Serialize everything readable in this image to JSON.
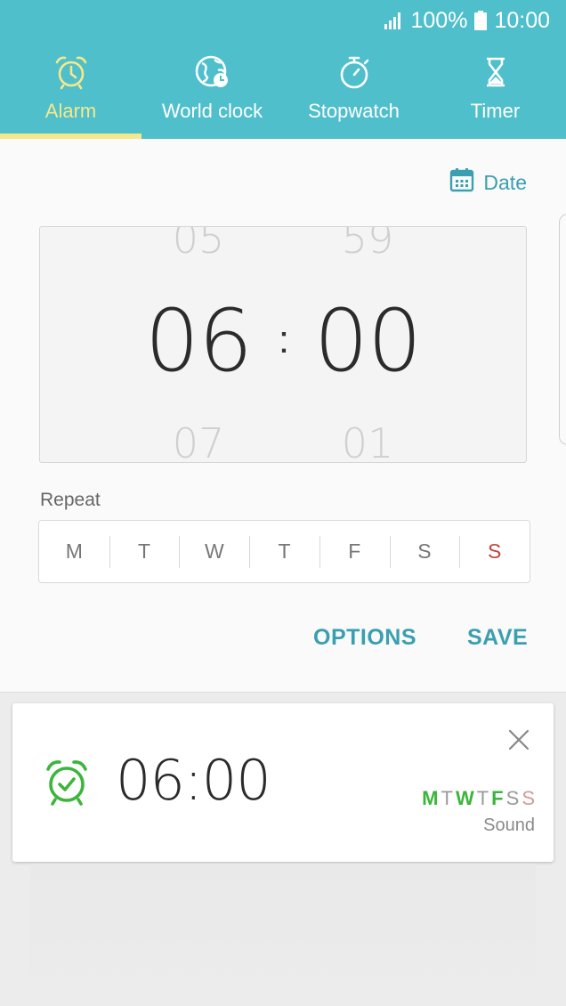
{
  "status": {
    "battery": "100%",
    "time": "10:00"
  },
  "tabs": [
    {
      "label": "Alarm",
      "icon": "alarm-clock-icon",
      "active": true
    },
    {
      "label": "World clock",
      "icon": "globe-clock-icon",
      "active": false
    },
    {
      "label": "Stopwatch",
      "icon": "stopwatch-icon",
      "active": false
    },
    {
      "label": "Timer",
      "icon": "hourglass-icon",
      "active": false
    }
  ],
  "editor": {
    "date_label": "Date",
    "picker": {
      "hour_prev": "05",
      "hour": "06",
      "hour_next": "07",
      "minute_prev": "59",
      "minute": "00",
      "minute_next": "01",
      "separator": ":"
    },
    "repeat_label": "Repeat",
    "days": [
      "M",
      "T",
      "W",
      "T",
      "F",
      "S",
      "S"
    ],
    "options_label": "OPTIONS",
    "save_label": "SAVE"
  },
  "alarm_card": {
    "time": "06:00",
    "days": [
      "M",
      "T",
      "W",
      "T",
      "F",
      "S",
      "S"
    ],
    "active_days": [
      true,
      false,
      true,
      false,
      true,
      false,
      false
    ],
    "sound_label": "Sound"
  },
  "colors": {
    "header": "#4fbfcc",
    "active_tab": "#f6e88a",
    "accent": "#3a9fb0",
    "alarm_on": "#3cb53c",
    "sunday": "#c0463f"
  }
}
